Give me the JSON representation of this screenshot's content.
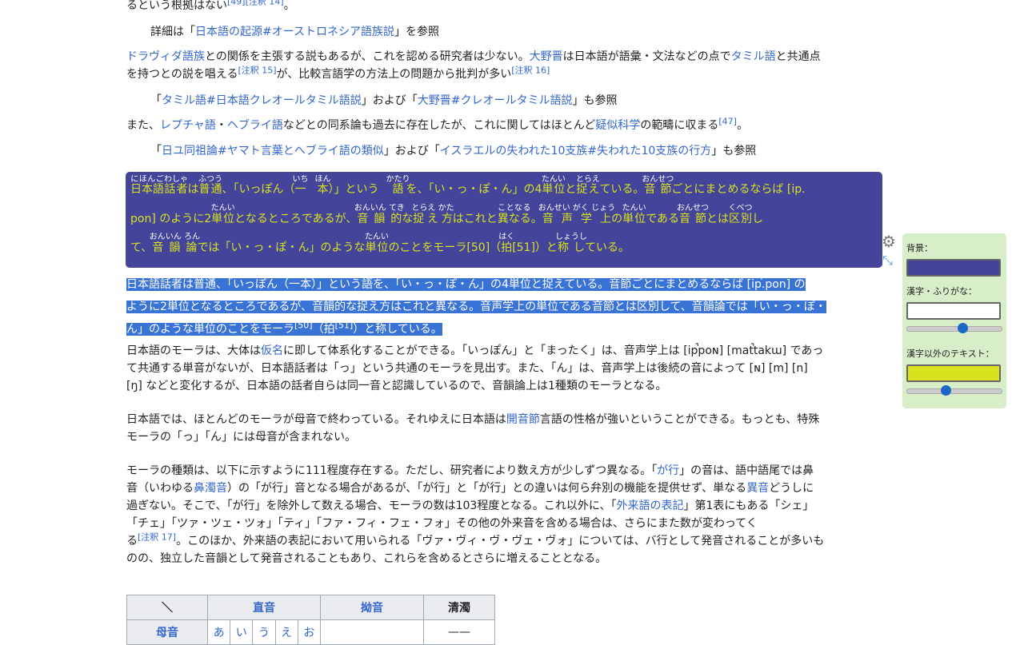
{
  "article": {
    "l1_text": "るという根拠はない",
    "l1_sup1": "[49]",
    "l1_sup2": "[注釈 14]",
    "l1_end": "。",
    "hat1_pre": "詳細は「",
    "hat1_link": "日本語の起源#オーストロネシア語族説",
    "hat1_post": "」を参照",
    "p2_link1": "ドラヴィダ語族",
    "p2_t1": "との関係を主張する説もあるが、これを認める研究者は少ない。",
    "p2_link2": "大野晋",
    "p2_t2": "は日本語が語彙・文法などの点で",
    "p2_link3": "タミル語",
    "p2_t3": "と共通点",
    "p2_l2a": "を持つとの説を唱える",
    "p2_sup1": "[注釈 15]",
    "p2_l2b": "が、比較言語学の方法上の問題から批判が多い",
    "p2_sup2": "[注釈 16]",
    "hat2_pre": "「",
    "hat2_link1": "タミル語#日本語クレオールタミル語説",
    "hat2_mid": "」および「",
    "hat2_link2": "大野晋#クレオールタミル語説",
    "hat2_post": "」も参照",
    "p3_t1": "また、",
    "p3_link1": "レプチャ語",
    "p3_t2": "・",
    "p3_link2": "ヘブライ語",
    "p3_t3": "などとの同系論も過去に存在したが、これに関してはほとんど",
    "p3_link3": "疑似科学",
    "p3_t4": "の範疇に収まる",
    "p3_sup": "[47]",
    "p3_end": "。",
    "hat3_pre": "「",
    "hat3_link1": "日ユ同祖論#ヤマト言葉とヘブライ語の類似",
    "hat3_mid": "」および「",
    "hat3_link2": "イスラエルの失われた10支族#失われた10支族の行方",
    "hat3_post": "」も参照"
  },
  "ruby": {
    "r1": [
      {
        "k": "日本語",
        "r": "にほんご"
      },
      {
        "k": "話者",
        "r": "わしゃ"
      },
      {
        "t": "は"
      },
      {
        "k": "普通",
        "r": "ふつう"
      },
      {
        "t": "、「いっぽん（"
      },
      {
        "k": "一",
        "r": "いち"
      },
      {
        "t": "　"
      },
      {
        "k": "本",
        "r": "ほん"
      },
      {
        "t": "）」という　"
      },
      {
        "k": "語",
        "r": "かたり"
      },
      {
        "t": "を、「い・っ・ぽ・ん」の4"
      },
      {
        "k": "単位",
        "r": "たんい"
      },
      {
        "t": "と"
      },
      {
        "k": "捉え",
        "r": "とらえ"
      },
      {
        "t": "ている。"
      },
      {
        "k": "音節",
        "r": "おんせつ"
      },
      {
        "t": "ごとにまとめるならば [ip."
      }
    ],
    "r2": [
      {
        "t": "pon] のように2"
      },
      {
        "k": "単位",
        "r": "たんい"
      },
      {
        "t": "となるところであるが、"
      },
      {
        "k": "音韻的",
        "r": "おんいん てき"
      },
      {
        "t": "な"
      },
      {
        "k": "捉え方",
        "r": "とらえ かた"
      },
      {
        "t": "はこれと"
      },
      {
        "k": "異なる",
        "r": "ことなる"
      },
      {
        "t": "。"
      },
      {
        "k": "音声学上",
        "r": "おんせい がく じょう"
      },
      {
        "t": "の"
      },
      {
        "k": "単位",
        "r": "たんい"
      },
      {
        "t": "である"
      },
      {
        "k": "音節",
        "r": "おんせつ"
      },
      {
        "t": "とは"
      },
      {
        "k": "区別",
        "r": "くべつ"
      },
      {
        "t": "し"
      }
    ],
    "r3": [
      {
        "t": "て、"
      },
      {
        "k": "音韻論",
        "r": "おんいん ろん"
      },
      {
        "t": "では「い・っ・ぽ・ん」のような"
      },
      {
        "k": "単位",
        "r": "たんい"
      },
      {
        "t": "のことをモーラ[50]（"
      },
      {
        "k": "拍",
        "r": "はく"
      },
      {
        "t": "[51]）と"
      },
      {
        "k": "称し",
        "r": "しょうし"
      },
      {
        "t": "ている。"
      }
    ]
  },
  "selected": {
    "l1": "日本語話者は普通、「いっぽん（一本）」という語を、「い・っ・ぽ・ん」の4単位と捉えている。音節ごとにまとめるならば [ip̚.pon] の",
    "l2": "ように2単位となるところであるが、音韻的な捉え方はこれと異なる。音声学上の単位である音節とは区別して、音韻論では「い・っ・ぽ・",
    "l3a": "ん」のような単位のことをモーラ",
    "l3_sup1": "[50]",
    "l3b": "（拍",
    "l3_sup2": "[51]",
    "l3c": "）と称している。"
  },
  "mora": {
    "p1_l1a": "日本語のモーラは、大体は",
    "p1_link": "仮名",
    "p1_l1b": "に即して体系化することができる。「いっぽん」と「まったく」は、音声学上は [ip̚poɴ] [mat̚takɯ] であっ",
    "p1_l2": "て共通する単音がないが、日本語話者は「っ」という共通のモーラを見出す。また、「ん」は、音声学上は後続の音によって [ɴ] [m] [n]",
    "p1_l3": "[ŋ] などと変化するが、日本語の話者自らは同一音と認識しているので、音韻論上は1種類のモーラとなる。",
    "p2_l1a": "日本語では、ほとんどのモーラが母音で終わっている。それゆえに日本語は",
    "p2_link": "開音節",
    "p2_l1b": "言語の性格が強いということができる。もっとも、特殊",
    "p2_l2": "モーラの「っ」「ん」には母音が含まれない。",
    "p3_l1a": "モーラの種類は、以下に示すように111程度存在する。ただし、研究者により数え方が少しずつ異なる。「",
    "p3_link1": "が行",
    "p3_l1b": "」の音は、語中語尾では鼻",
    "p3_l2a": "音（いわゆる",
    "p3_link2": "鼻濁音",
    "p3_l2b": "）の「が行」音となる場合があるが、「が行」と「が行」との違いは何ら弁別の機能を提供せず、単なる",
    "p3_link3": "異音",
    "p3_l2c": "どうしに",
    "p3_l3a": "過ぎない。そこで、「が行」を除外して数える場合、モーラの数は103程度となる。これ以外に、「",
    "p3_link4": "外来語の表記",
    "p3_l3b": "」第1表にもある「シェ」",
    "p3_l4": "「チェ」「ツァ・ツェ・ツォ」「ティ」「ファ・フィ・フェ・フォ」その他の外来音を含める場合は、さらにまた数が変わってく",
    "p3_l5a": "る",
    "p3_sup": "[注釈 17]",
    "p3_l5b": "。このほか、外来語の表記において用いられる「ヴァ・ヴィ・ヴ・ヴェ・ヴォ」については、バ行として発音されることが多いも",
    "p3_l6": "のの、独立した音韻として発音されることもあり、これらを含めるとさらに増えることとなる。"
  },
  "table": {
    "corner": "＼",
    "h1": "直音",
    "h2": "拗音",
    "h3": "清濁",
    "row_label": "母音",
    "cells": [
      "あ",
      "い",
      "う",
      "え",
      "お"
    ],
    "dash": "——"
  },
  "settings": {
    "bg_label": "背景：",
    "bg_color": "#44449a",
    "kanji_label": "漢字・ふりがな：",
    "kanji_color": "#ffffff",
    "kanji_size": 0.6,
    "other_label": "漢字以外のテキスト：",
    "other_color": "#d9e21e",
    "other_size": 0.4
  }
}
